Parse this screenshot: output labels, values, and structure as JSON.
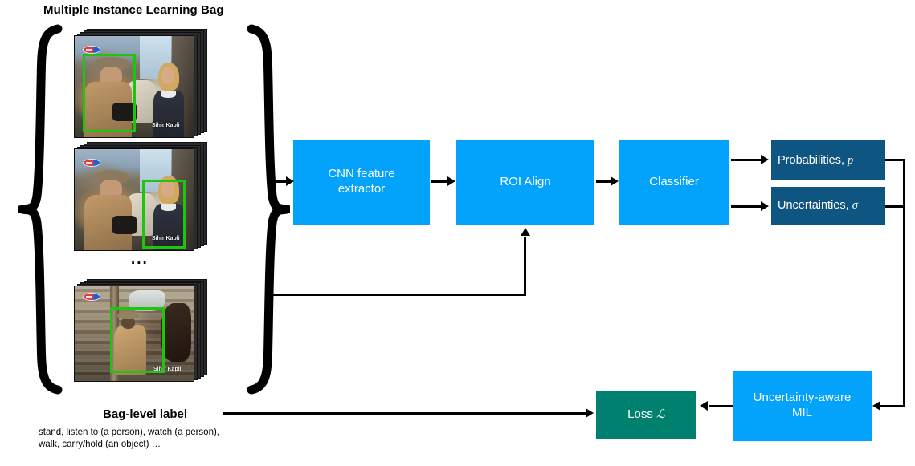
{
  "figure": {
    "title": "Multiple Instance Learning Bag"
  },
  "bag": {
    "ellipsis": "...",
    "frames": [
      {
        "name": "frame-1",
        "watermark_logo": "trt1-logo",
        "watermark_text": "Sihir Kapli"
      },
      {
        "name": "frame-2",
        "watermark_logo": "trt1-logo",
        "watermark_text": "Sihir Kapli"
      },
      {
        "name": "frame-3",
        "watermark_logo": "trt1-logo",
        "watermark_text": "Sihir Kapli"
      }
    ]
  },
  "pipeline": {
    "cnn": {
      "line1": "CNN feature",
      "line2": "extractor"
    },
    "roi": {
      "label": "ROI Align"
    },
    "classifier": {
      "label": "Classifier"
    },
    "probabilities": {
      "prefix": "Probabilities, ",
      "symbol": "p"
    },
    "uncertainties": {
      "prefix": "Uncertainties, ",
      "symbol": "σ"
    },
    "mil": {
      "line1": "Uncertainty-aware",
      "line2": "MIL"
    },
    "loss": {
      "prefix": "Loss ",
      "symbol": "ℒ"
    }
  },
  "labels": {
    "bag_level_label": "Bag-level label",
    "bag_classes": "stand, listen to (a person), watch (a person),\nwalk, carry/hold (an object) …"
  },
  "colors": {
    "blue": "#03a3fb",
    "navy": "#0f5582",
    "teal": "#00806f",
    "bbox_green": "#1fc40f",
    "arrow_black": "#000000",
    "background": "#ffffff"
  }
}
